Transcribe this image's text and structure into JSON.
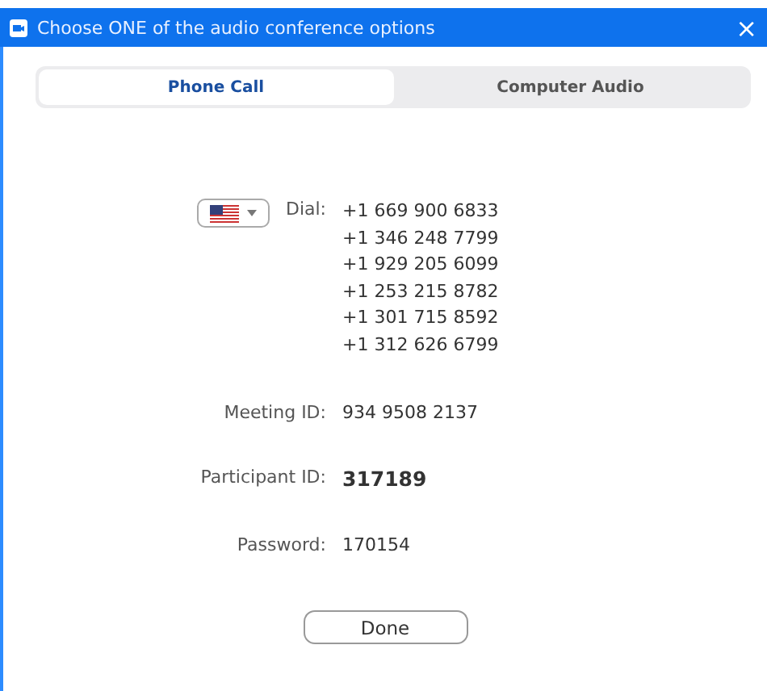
{
  "window": {
    "title": "Choose ONE of the audio conference options",
    "close": "×"
  },
  "tabs": [
    {
      "label": "Phone Call",
      "selected": true
    },
    {
      "label": "Computer Audio",
      "selected": false
    }
  ],
  "dial": {
    "label": "Dial:",
    "numbers": [
      "+1 669 900 6833",
      "+1 346 248 7799",
      "+1 929 205 6099",
      "+1 253 215 8782",
      "+1 301 715 8592",
      "+1 312 626 6799"
    ]
  },
  "fields": [
    {
      "label": "Meeting ID:",
      "value": "934 9508 2137",
      "bold": false
    },
    {
      "label": "Participant ID:",
      "value": "317189",
      "bold": true
    },
    {
      "label": "Password:",
      "value": "170154",
      "bold": false
    }
  ],
  "buttons": [
    "Done"
  ]
}
